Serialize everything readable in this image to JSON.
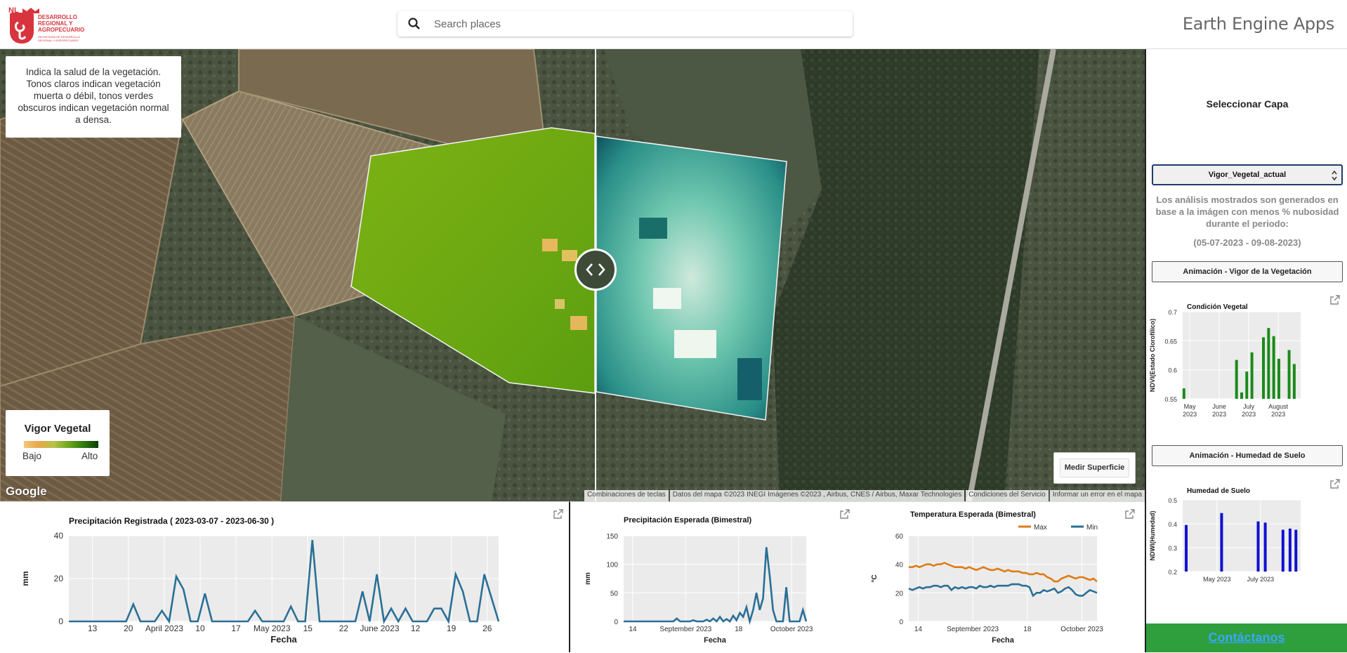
{
  "header": {
    "logo": {
      "badge": "NL",
      "org_name": "DESARROLLO REGIONAL Y AGROPECUARIO",
      "sub_text": "SECRETARÍA DE DESARROLLO REGIONAL Y AGROPECUARIO"
    },
    "search": {
      "placeholder": "Search places",
      "value": ""
    },
    "app_title": "Earth Engine Apps"
  },
  "map": {
    "info_text": "Indica la salud de la vegetación. Tonos claros indican vegetación muerta o débil, tonos verdes obscuros indican vegetación normal a densa.",
    "legend": {
      "title": "Vigor Vegetal",
      "low": "Bajo",
      "high": "Alto"
    },
    "google_logo": "Google",
    "attribution": [
      "Combinaciones de teclas",
      "Datos del mapa ©2023 INEGI Imágenes ©2023 , Airbus, CNES / Airbus, Maxar Technologies",
      "Condiciones del Servicio",
      "Informar un error en el mapa"
    ],
    "measure_button": "Medir Superficie"
  },
  "right_panel": {
    "select_title": "Seleccionar Capa",
    "layer_selected": "Vigor_Vegetal_actual",
    "analysis_note": "Los análisis mostrados son generados en base a la imágen con menos % nubosidad durante el periodo:",
    "date_range": "(05-07-2023 - 09-08-2023)",
    "btn_anim_vigor": "Animación - Vigor de la Vegetación",
    "btn_anim_humedad": "Animación - Humedad de Suelo",
    "contact": "Contáctanos"
  },
  "colors": {
    "precip": "#2a6f97",
    "tmax": "#e07b14",
    "tmin": "#2a6f97",
    "ndvi_bar": "#1a8a1a",
    "ndwi_bar": "#1010d0"
  },
  "chart_data": [
    {
      "id": "precip_registrada",
      "type": "line",
      "title": "Precipitación Registrada ( 2023-03-07 - 2023-06-30 )",
      "xlabel": "Fecha",
      "ylabel": "mm",
      "ylim": [
        0,
        40
      ],
      "yticks": [
        0,
        20,
        40
      ],
      "xticks": [
        "13",
        "20",
        "April 2023",
        "10",
        "17",
        "May 2023",
        "15",
        "22",
        "June 2023",
        "12",
        "19",
        "26"
      ],
      "x": [
        0,
        8,
        9,
        10,
        12,
        13,
        14,
        15,
        16,
        17,
        18,
        19,
        20,
        25,
        26,
        27,
        29,
        30,
        31,
        32,
        33,
        34,
        35,
        40,
        41,
        42,
        43,
        44,
        45,
        46,
        47,
        48,
        49,
        50,
        51,
        52,
        53,
        54,
        55,
        56,
        57,
        58,
        60
      ],
      "values": [
        0,
        0,
        8,
        0,
        0,
        5,
        0,
        21,
        15,
        0,
        0,
        13,
        0,
        0,
        5,
        0,
        0,
        0,
        7,
        0,
        0,
        38,
        0,
        0,
        14,
        0,
        22,
        0,
        6,
        0,
        6,
        0,
        0,
        0,
        6,
        6,
        0,
        22,
        14,
        0,
        0,
        22,
        0
      ]
    },
    {
      "id": "precip_esperada",
      "type": "line",
      "title": "Precipitación Esperada (Bimestral)",
      "xlabel": "Fecha",
      "ylabel": "mm",
      "ylim": [
        0,
        150
      ],
      "yticks": [
        0,
        50,
        100,
        150
      ],
      "xticks": [
        "14",
        "September 2023",
        "18",
        "October 2023"
      ],
      "values": [
        0,
        0,
        0,
        0,
        0,
        0,
        0,
        0,
        0,
        0,
        0,
        0,
        0,
        0,
        0,
        0,
        5,
        0,
        0,
        0,
        0,
        2,
        0,
        0,
        0,
        3,
        0,
        5,
        0,
        8,
        0,
        4,
        0,
        10,
        2,
        15,
        8,
        25,
        0,
        20,
        50,
        20,
        40,
        130,
        80,
        20,
        0,
        0,
        0,
        60,
        0,
        0,
        0,
        0,
        20,
        0
      ]
    },
    {
      "id": "temp_esperada",
      "type": "line",
      "title": "Temperatura Esperada (Bimestral)",
      "xlabel": "Fecha",
      "ylabel": "°C",
      "ylim": [
        0,
        60
      ],
      "yticks": [
        0,
        20,
        40,
        60
      ],
      "xticks": [
        "14",
        "September 2023",
        "18",
        "October 2023"
      ],
      "series": [
        {
          "name": "Max",
          "values": [
            38,
            38,
            39,
            38,
            39,
            40,
            40,
            39,
            40,
            40,
            41,
            40,
            39,
            38,
            38,
            38,
            37,
            38,
            37,
            36,
            37,
            38,
            37,
            36,
            36,
            37,
            36,
            35,
            36,
            35,
            35,
            35,
            34,
            34,
            33,
            33,
            34,
            33,
            33,
            31,
            30,
            28,
            28,
            30,
            31,
            32,
            31,
            30,
            31,
            31,
            30,
            29,
            30,
            28
          ]
        },
        {
          "name": "Min",
          "values": [
            23,
            22,
            23,
            24,
            23,
            24,
            24,
            25,
            25,
            24,
            25,
            25,
            22,
            24,
            23,
            24,
            23,
            24,
            24,
            23,
            25,
            24,
            24,
            25,
            24,
            25,
            25,
            25,
            25,
            26,
            26,
            26,
            25,
            25,
            24,
            18,
            20,
            20,
            22,
            21,
            22,
            23,
            20,
            21,
            23,
            24,
            22,
            19,
            18,
            18,
            20,
            22,
            21,
            20
          ]
        }
      ]
    },
    {
      "id": "condicion_vegetal",
      "type": "bar",
      "title": "Condición Vegetal",
      "ylabel": "NDVI(Estado Clorofílico)",
      "ylim": [
        0.55,
        0.7
      ],
      "yticks": [
        0.55,
        0.6,
        0.65,
        0.7
      ],
      "xticks": [
        "May 2023",
        "June 2023",
        "July 2023",
        "August 2023"
      ],
      "x": [
        1,
        42,
        46,
        50,
        54,
        63,
        67,
        71,
        75,
        83,
        87
      ],
      "values": [
        0.568,
        0.617,
        0.561,
        0.597,
        0.63,
        0.656,
        0.672,
        0.658,
        0.619,
        0.634,
        0.61
      ]
    },
    {
      "id": "humedad_suelo",
      "type": "bar",
      "title": "Humedad de Suelo",
      "ylabel": "NDWI(Humedad)",
      "ylim": [
        0.2,
        0.5
      ],
      "yticks": [
        0.2,
        0.3,
        0.4,
        0.5
      ],
      "xticks": [
        "May 2023",
        "July 2023"
      ],
      "x": [
        3,
        33,
        64,
        70,
        85,
        91,
        96
      ],
      "values": [
        0.395,
        0.445,
        0.41,
        0.405,
        0.375,
        0.38,
        0.375
      ]
    }
  ]
}
